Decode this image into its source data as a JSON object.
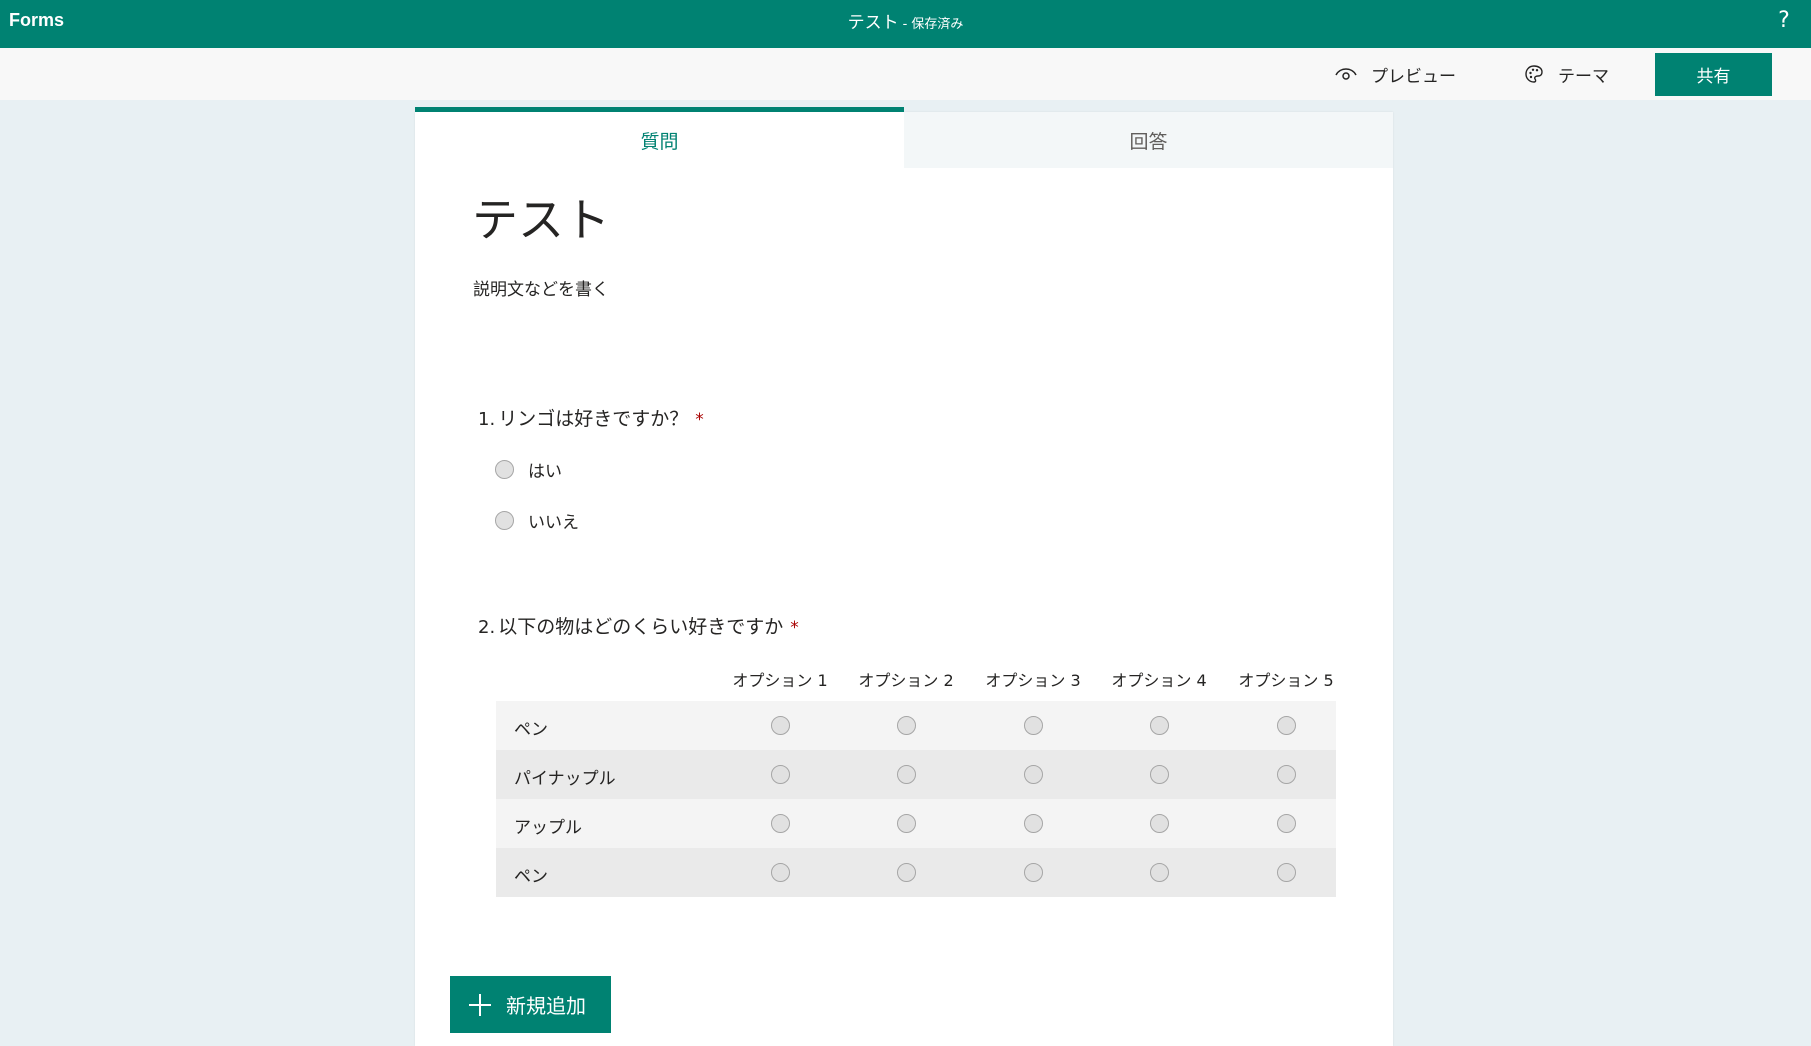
{
  "app": {
    "name": "Forms",
    "help": "?"
  },
  "header": {
    "form_name": "テスト",
    "separator": "-",
    "save_status": "保存済み"
  },
  "toolbar": {
    "preview": "プレビュー",
    "theme": "テーマ",
    "share": "共有"
  },
  "tabs": [
    {
      "label": "質問",
      "active": true
    },
    {
      "label": "回答",
      "active": false
    }
  ],
  "form": {
    "title": "テスト",
    "description": "説明文などを書く"
  },
  "questions": [
    {
      "number": "1.",
      "text": "リンゴは好きですか？",
      "required_mark": "*",
      "choices": [
        "はい",
        "いいえ"
      ]
    },
    {
      "number": "2.",
      "text": "以下の物はどのくらい好きですか",
      "required_mark": "*",
      "columns": [
        "オプション 1",
        "オプション 2",
        "オプション 3",
        "オプション 4",
        "オプション 5"
      ],
      "rows": [
        "ペン",
        "パイナップル",
        "アップル",
        "ペン"
      ]
    }
  ],
  "add_new": {
    "label": "新規追加"
  },
  "colors": {
    "accent": "#008272",
    "required": "#a80000",
    "background": "#e8f0f3"
  }
}
